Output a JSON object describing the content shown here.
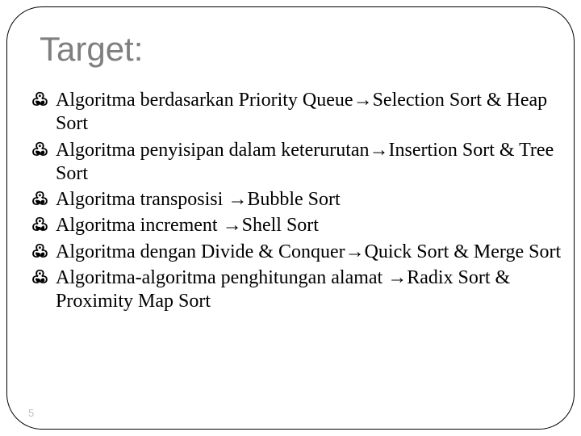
{
  "title": "Target:",
  "arrow": "→",
  "bullets": [
    {
      "pre": "Algoritma berdasarkan Priority Queue",
      "post": "Selection Sort & Heap Sort"
    },
    {
      "pre": "Algoritma penyisipan dalam keterurutan",
      "post": "Insertion Sort & Tree Sort"
    },
    {
      "pre": "Algoritma transposisi ",
      "post": "Bubble Sort"
    },
    {
      "pre": "Algoritma increment ",
      "post": "Shell Sort"
    },
    {
      "pre": "Algoritma dengan Divide & Conquer",
      "post": "Quick Sort & Merge Sort"
    },
    {
      "pre": "Algoritma-algoritma penghitungan alamat ",
      "post": "Radix Sort & Proximity Map Sort"
    }
  ],
  "page_number": "5",
  "bullet_glyph": "߷"
}
